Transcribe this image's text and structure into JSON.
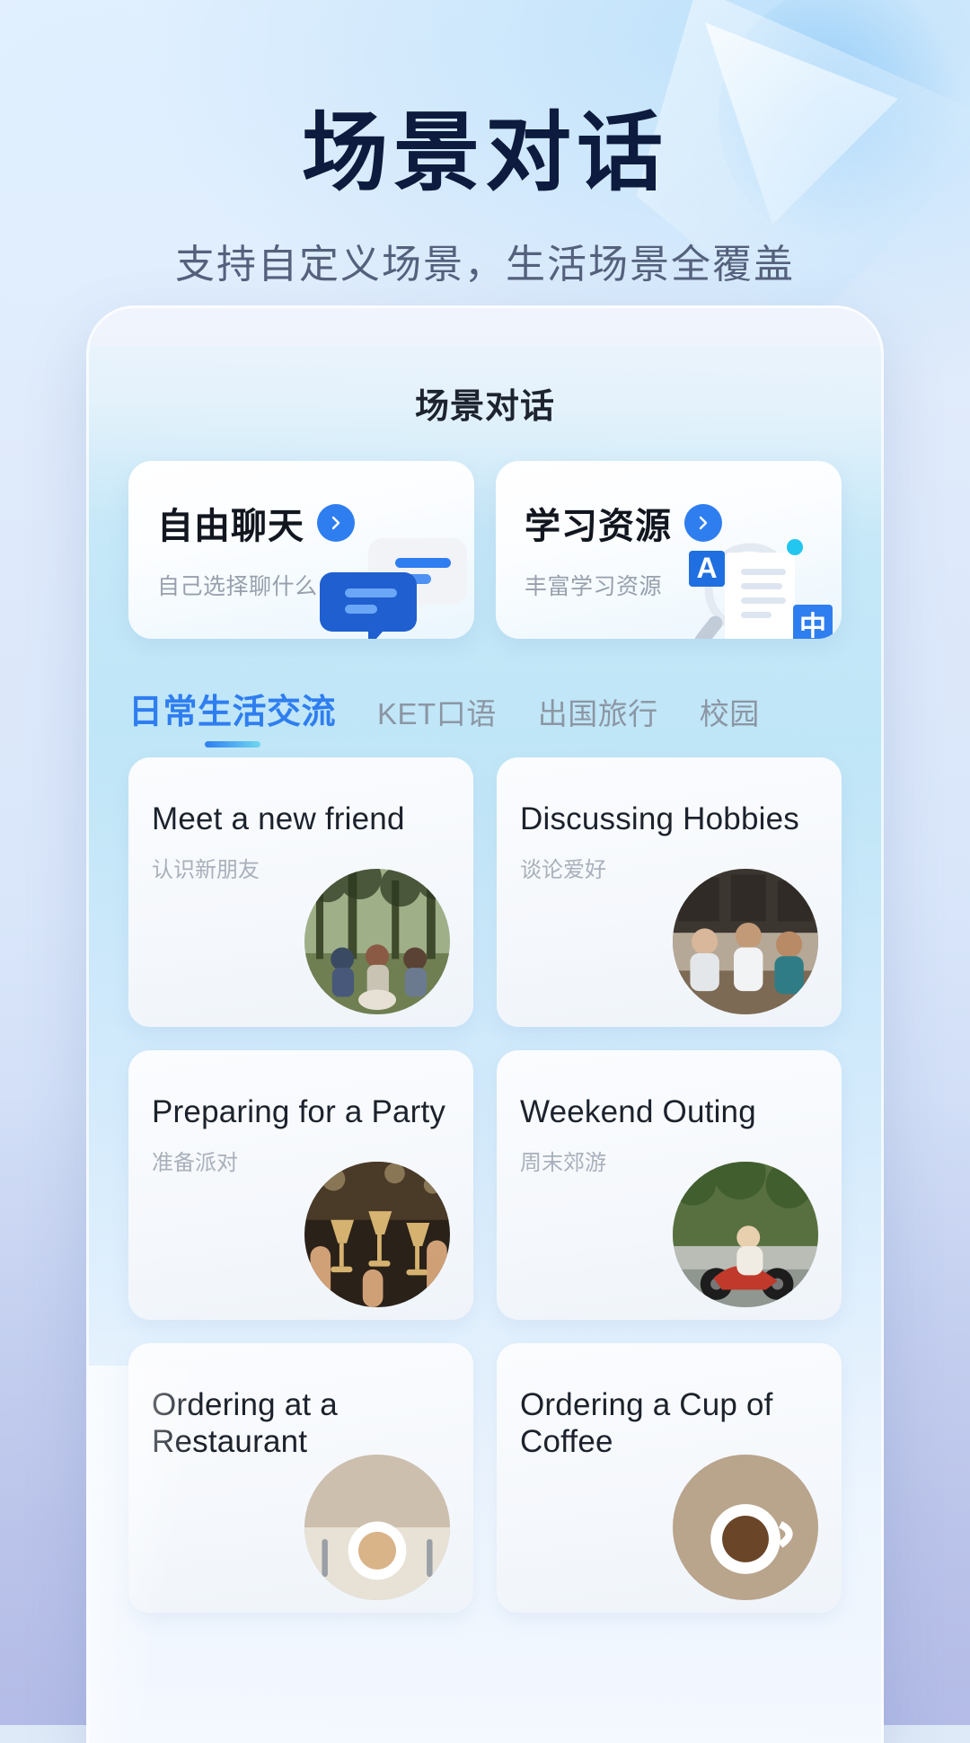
{
  "hero": {
    "title": "场景对话",
    "subtitle": "支持自定义场景，生活场景全覆盖"
  },
  "phone": {
    "screen_title": "场景对话",
    "feature_cards": [
      {
        "title": "自由聊天",
        "subtitle": "自己选择聊什么",
        "arrow_icon": "chevron-right-icon",
        "illustration": "chat-bubbles-illustration"
      },
      {
        "title": "学习资源",
        "subtitle": "丰富学习资源",
        "arrow_icon": "chevron-right-icon",
        "illustration": "document-magnifier-illustration",
        "badges": [
          "A",
          "中"
        ]
      }
    ],
    "tabs": [
      {
        "label": "日常生活交流",
        "active": true
      },
      {
        "label": "KET口语",
        "active": false
      },
      {
        "label": "出国旅行",
        "active": false
      },
      {
        "label": "校园",
        "active": false
      }
    ],
    "scenes": [
      {
        "title_en": "Meet a new friend",
        "title_zh": "认识新朋友",
        "thumb": "friends-picnic-photo"
      },
      {
        "title_en": "Discussing Hobbies",
        "title_zh": "谈论爱好",
        "thumb": "cafe-friends-photo"
      },
      {
        "title_en": "Preparing for a Party",
        "title_zh": "准备派对",
        "thumb": "party-toast-photo"
      },
      {
        "title_en": "Weekend Outing",
        "title_zh": "周末郊游",
        "thumb": "motorbike-outing-photo"
      },
      {
        "title_en": "Ordering at a Restaurant",
        "title_zh": "",
        "thumb": "restaurant-photo"
      },
      {
        "title_en": "Ordering a Cup of Coffee",
        "title_zh": "",
        "thumb": "coffee-photo"
      }
    ]
  },
  "colors": {
    "accent_blue": "#2f7ef0",
    "accent_cyan": "#6fd7f0",
    "hero_text": "#0d1b3e",
    "muted_text": "#97a0ac"
  }
}
